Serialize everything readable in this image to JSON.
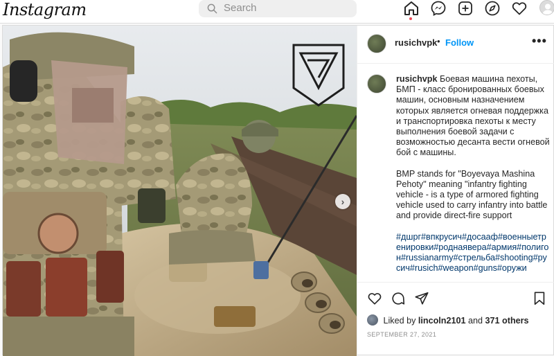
{
  "app": {
    "logo_text": "Instagram"
  },
  "search": {
    "placeholder": "Search"
  },
  "nav": {
    "icons": [
      "home-icon",
      "messenger-icon",
      "new-post-icon",
      "explore-icon",
      "activity-heart-icon",
      "profile-avatar"
    ]
  },
  "post": {
    "username": "rusichvpk",
    "follow_label": "Follow",
    "more_label": "•••",
    "caption": {
      "username": "rusichvpk",
      "text_ru": "Боевая машина пехоты, БМП - класс бронированных боевых машин, основным назначением которых является огневая поддержка и транспортировка пехоты к месту выполнения боевой задачи с возможностью десанта вести огневой бой с машины.",
      "text_en": "BMP stands for \"Boyevaya Mashina Pehoty\" meaning \"infantry fighting vehicle - is a type of armored fighting vehicle used to carry infantry into battle and provide direct-fire support",
      "hashtags": "#дшрг#впкрусич#досааф#военныетренировки#роднаявера#армия#полигон#russianarmy#стрельба#shooting#русич#rusich#weapon#guns#оружи"
    },
    "likes": {
      "prefix": "Liked by",
      "user": "lincoln2101",
      "and": "and",
      "others": "371 others"
    },
    "date": "SEPTEMBER 27, 2021"
  },
  "colors": {
    "accent": "#0095f6",
    "notification": "#ed4956",
    "hashtag": "#00376b"
  }
}
